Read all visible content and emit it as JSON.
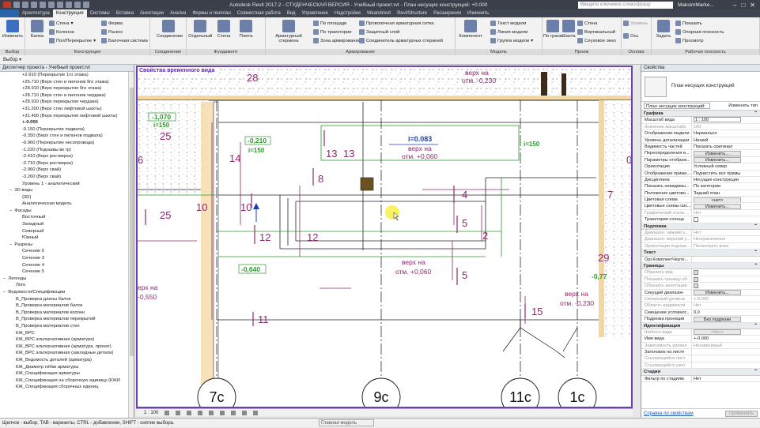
{
  "titlebar": {
    "title": "Autodesk Revit 2017.2 - СТУДЕНЧЕСКАЯ ВЕРСИЯ -    Учебный проект.rvt - План несущих конструкций: +0.000",
    "search_placeholder": "Введите ключевое слово/фразу",
    "user": "MaksimMarke..."
  },
  "tabs": [
    "Архитектура",
    "Конструкция",
    "Системы",
    "Вставка",
    "Аннотации",
    "Анализ",
    "Формы и генплан",
    "Совместная работа",
    "Вид",
    "Управление",
    "Надстройки",
    "Weandrevit",
    "RevitStructure",
    "Расширения",
    "Изменить"
  ],
  "active_tab": "Конструкция",
  "ribbon": {
    "groups": {
      "select": "Выбор",
      "structure": "Конструкция",
      "connection": "Соединение",
      "foundation": "Фундамент",
      "reinforcement": "Армирование",
      "model": "Модель",
      "opening": "Проем",
      "datum": "Основа",
      "workplane": "Рабочая плоскость"
    },
    "buttons": {
      "modify": "Изменить",
      "beam": "Балка",
      "wall": "Стена",
      "column": "Колонна",
      "floor_ceiling": "Пол/Перекрытие",
      "truss": "Ферма",
      "brace": "Раскос",
      "beam_system": "Балочная система",
      "connection": "Соединение",
      "isolated": "Отдельный",
      "wall_found": "Стена",
      "slab": "Плита",
      "rebar": "Арматурный стержень",
      "area": "По площади",
      "path": "По траектории",
      "area_reinf": "Зона армирования",
      "fabric": "Проволочная арматурная сетка",
      "cover": "Защитный слой",
      "coupler": "Соединитель арматурных стержней",
      "component": "Компонент",
      "model_text": "Текст модели",
      "model_line": "Линия модели",
      "model_group": "Группа модели",
      "by_face": "По грани",
      "shaft": "Шахта",
      "wall_open": "Стена",
      "vertical": "Вертикальный",
      "dormer": "Слуховое окно",
      "level": "Уровень",
      "grid": "Ось",
      "set": "Задать",
      "show": "Показать",
      "ref_plane": "Опорная плоскость",
      "viewer": "Просмотр"
    }
  },
  "browser": {
    "title": "Диспетчер проекта - Учебный проект.rvt",
    "items": [
      {
        "indent": 3,
        "text": "+2.910 (Перекрытие 1го этажа)"
      },
      {
        "indent": 3,
        "text": "+26.710 (Верх стен и пилонов 9го этажа)"
      },
      {
        "indent": 3,
        "text": "+28.910 (Верх перекрытия 9го этажа)"
      },
      {
        "indent": 3,
        "text": "+28.710 (Верх стен и пилонов чердака)"
      },
      {
        "indent": 3,
        "text": "+28.910 (Верх перекрытия чердака)"
      },
      {
        "indent": 3,
        "text": "+31.200 (Верх стен лифтовой шахты)"
      },
      {
        "indent": 3,
        "text": "+31.400 (Верх перекрытия лифтовой шахты)"
      },
      {
        "indent": 3,
        "text": "+-0.000",
        "bold": true
      },
      {
        "indent": 3,
        "text": "-0.150 (Перекрытие подвала)"
      },
      {
        "indent": 3,
        "text": "-0.350 (Верх стен и пилонов подвала)"
      },
      {
        "indent": 3,
        "text": "-0.960 (Перекрытие несопровода)"
      },
      {
        "indent": 3,
        "text": "-1.220 (Подошвы вк гр)"
      },
      {
        "indent": 3,
        "text": "-2.410 (Верх ростверка)"
      },
      {
        "indent": 3,
        "text": "-2.710 (Верх ростверка)"
      },
      {
        "indent": 3,
        "text": "-2.960 (Верх свай)"
      },
      {
        "indent": 3,
        "text": "-3.260 (Верх свай)"
      },
      {
        "indent": 3,
        "text": "Уровень 1 - аналитический"
      },
      {
        "indent": 1,
        "text": "3D виды",
        "expander": "−"
      },
      {
        "indent": 3,
        "text": "{3D}"
      },
      {
        "indent": 3,
        "text": "Аналитическая модель"
      },
      {
        "indent": 1,
        "text": "Фасады",
        "expander": "−"
      },
      {
        "indent": 3,
        "text": "Восточный"
      },
      {
        "indent": 3,
        "text": "Западный"
      },
      {
        "indent": 3,
        "text": "Северный"
      },
      {
        "indent": 3,
        "text": "Южный"
      },
      {
        "indent": 1,
        "text": "Разрезы",
        "expander": "−"
      },
      {
        "indent": 3,
        "text": "Сечение 0"
      },
      {
        "indent": 3,
        "text": "Сечение 3"
      },
      {
        "indent": 3,
        "text": "Сечение 4"
      },
      {
        "indent": 3,
        "text": "Сечение 5"
      },
      {
        "indent": 0,
        "text": "Легенды",
        "expander": "−"
      },
      {
        "indent": 2,
        "text": "Лого"
      },
      {
        "indent": 0,
        "text": "Ведомости/Спецификации",
        "expander": "−"
      },
      {
        "indent": 2,
        "text": "В_Проверка длины балок"
      },
      {
        "indent": 2,
        "text": "В_Проверка материалов балок"
      },
      {
        "indent": 2,
        "text": "В_Проверка материалов колонн"
      },
      {
        "indent": 2,
        "text": "В_Проверка материалов перекрытий"
      },
      {
        "indent": 2,
        "text": "В_Проверка материалов стен"
      },
      {
        "indent": 2,
        "text": "КЖ_ВРС"
      },
      {
        "indent": 2,
        "text": "КЖ_ВРС альтернативная (арматура)"
      },
      {
        "indent": 2,
        "text": "КЖ_ВРС альтернативная (арматура, прокат)"
      },
      {
        "indent": 2,
        "text": "КЖ_ВРС альтернативная (закладные детали)"
      },
      {
        "indent": 2,
        "text": "КЖ_Ведомость деталей (арматура)"
      },
      {
        "indent": 2,
        "text": "КЖ_Диаметр гибки арматуры"
      },
      {
        "indent": 2,
        "text": "КЖ_Спецификация арматуры"
      },
      {
        "indent": 2,
        "text": "КЖ_Спецификация на сборочную единицу (КЖИ"
      },
      {
        "indent": 2,
        "text": "КЖ_Спецификация сборочных единиц"
      }
    ]
  },
  "view": {
    "title": "Свойства временного вида",
    "scale": "1 : 100",
    "grids": [
      "7с",
      "9с",
      "11с",
      "1с"
    ],
    "labels": {
      "l28": "28",
      "l25a": "25",
      "l25b": "25",
      "l14": "14",
      "l13a": "13",
      "l13b": "13",
      "l10a": "10",
      "l10b": "10",
      "l12a": "12",
      "l12b": "12",
      "l11": "11",
      "l8": "8",
      "l4": "4",
      "l5a": "5",
      "l5b": "5",
      "l2": "2",
      "l15": "15",
      "l6": "6",
      "l29": "29",
      "l7": "7",
      "e1070": "-1,070",
      "i150a": "i=150",
      "e0210": "-0,210",
      "i150b": "i=150",
      "i150c": "i=150",
      "i083": "i=0.083",
      "e0640": "-0,640",
      "e0550": "-0,550",
      "e0230a": "-0,230",
      "e0230b": "-0,230",
      "top1": "верх на",
      "top1b": "отм. +0,060",
      "top2": "верх на",
      "top2b": "отм. +0,060",
      "top3": "верх на",
      "top3b": "отм. -0,230",
      "top4": "верх на",
      "top4b": "отм. -0,230",
      "top5": "верх на",
      "e0550pre": "ерх на",
      "e077": "-0,77",
      "e0": "0"
    }
  },
  "props": {
    "title": "Свойства",
    "type_name": "План несущих конструкций",
    "type_select": "План несущих конструкций: ",
    "edit_type": "Изменить тип",
    "sections": [
      {
        "name": "Графика",
        "rows": [
          {
            "k": "Масштаб вида",
            "v": "1 : 100",
            "box": true
          },
          {
            "k": "Значение масштаба",
            "v": "100",
            "grey": true
          },
          {
            "k": "Отображение модели",
            "v": "Нормально"
          },
          {
            "k": "Уровень детализации",
            "v": "Низкий"
          },
          {
            "k": "Видимость частей",
            "v": "Показать оригинал"
          },
          {
            "k": "Переопределения в...",
            "v": "Изменить...",
            "btn": true
          },
          {
            "k": "Параметры отображ...",
            "v": "Изменить...",
            "btn": true
          },
          {
            "k": "Ориентация",
            "v": "Условный север"
          },
          {
            "k": "Отображение приме...",
            "v": "Подчистить все примы"
          },
          {
            "k": "Дисциплина",
            "v": "Несущие конструкции"
          },
          {
            "k": "Показать невидимы...",
            "v": "По категории"
          },
          {
            "k": "Положение цветово...",
            "v": "Задний план"
          },
          {
            "k": "Цветовая схема",
            "v": "<нет>",
            "btn": true
          },
          {
            "k": "Цветовые схемы сис...",
            "v": "Изменить...",
            "btn": true
          },
          {
            "k": "Графический стиль ...",
            "v": "Нет",
            "grey": true
          },
          {
            "k": "Траектория солнца",
            "v": "",
            "check": true
          }
        ]
      },
      {
        "name": "Подложка",
        "rows": [
          {
            "k": "Диапазон: нижний у...",
            "v": "Нет",
            "grey": true
          },
          {
            "k": "Диапазон: верхний у...",
            "v": "Неограниченно",
            "grey": true
          },
          {
            "k": "Ориентация подлож...",
            "v": "Посмотреть вниз",
            "grey": true
          }
        ]
      },
      {
        "name": "Текст",
        "rows": [
          {
            "k": "Орг.КомплектЧерте...",
            "v": ""
          }
        ]
      },
      {
        "name": "Границы",
        "rows": [
          {
            "k": "Обрезать вид",
            "v": "",
            "check": true,
            "grey": true
          },
          {
            "k": "Показать границу об...",
            "v": "",
            "check": true,
            "grey": true
          },
          {
            "k": "Обрезать аннотации",
            "v": "",
            "check": true,
            "grey": true
          },
          {
            "k": "Секущий диапазон",
            "v": "Изменить...",
            "btn": true
          },
          {
            "k": "Связанный уровень",
            "v": "+-0.000",
            "grey": true
          },
          {
            "k": "Область видимости",
            "v": "Нет",
            "grey": true
          },
          {
            "k": "Смещение условног...",
            "v": "0,0"
          },
          {
            "k": "Подрезка проекции",
            "v": "Без подрезки",
            "btn": true
          }
        ]
      },
      {
        "name": "Идентификация",
        "rows": [
          {
            "k": "Шаблон вида",
            "v": "<Нет>",
            "btn": true,
            "grey": true
          },
          {
            "k": "Имя вида",
            "v": "+-0.000"
          },
          {
            "k": "Зависимость уровня",
            "v": "Независимый",
            "grey": true
          },
          {
            "k": "Заголовок на листе",
            "v": ""
          },
          {
            "k": "Ссылающийся лист",
            "v": "",
            "grey": true
          },
          {
            "k": "Ссылающийся узел",
            "v": "",
            "grey": true
          }
        ]
      },
      {
        "name": "Стадии",
        "rows": [
          {
            "k": "Фильтр по стадиям",
            "v": "Нет"
          }
        ]
      }
    ],
    "help_link": "Справка по свойствам",
    "apply": "Применить"
  },
  "options_bar": {
    "select_label": "Выбор ▾"
  },
  "status": {
    "message": "Щелчок - выбор, TAB - варианты, CTRL - добавление, SHIFT - снятие выбора.",
    "model": "Главная модель"
  }
}
